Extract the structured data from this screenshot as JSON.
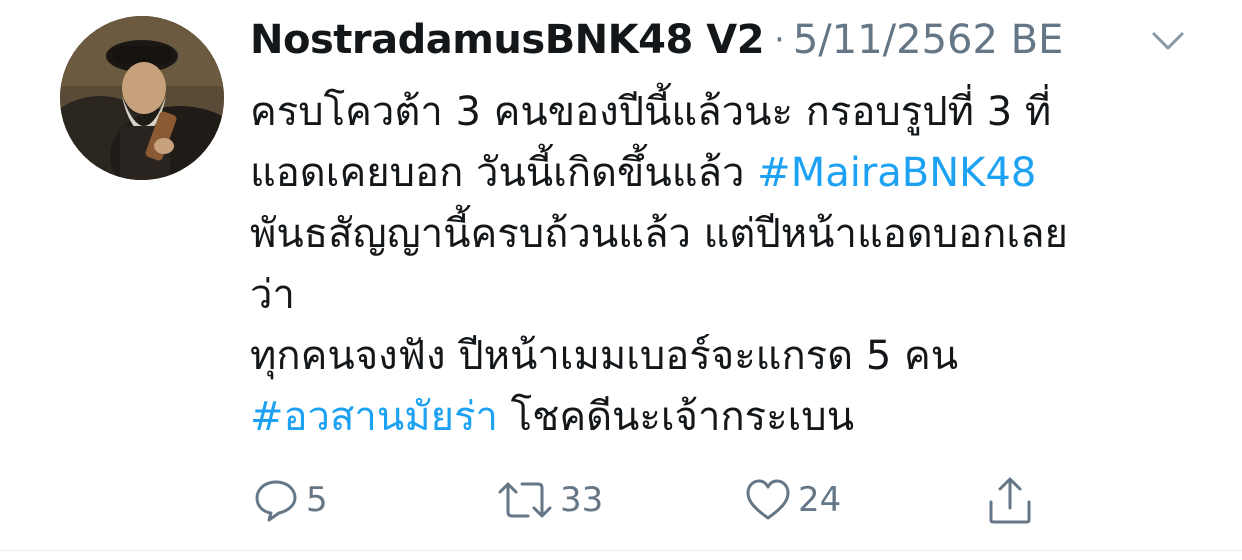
{
  "tweet": {
    "display_name": "NostradamusBNK48 V2",
    "separator": "·",
    "timestamp": "5/11/2562 BE",
    "lines": [
      {
        "segments": [
          {
            "text": "ครบโควต้า 3 คนของปีนี้แล้วนะ กรอบรูปที่ 3 ที่",
            "hashtag": false
          }
        ]
      },
      {
        "segments": [
          {
            "text": "แอดเคยบอก วันนี้เกิดขึ้นแล้ว ",
            "hashtag": false
          },
          {
            "text": "#MairaBNK48",
            "hashtag": true
          }
        ]
      },
      {
        "segments": [
          {
            "text": "พันธสัญญานี้ครบถ้วนแล้ว แต่ปีหน้าแอดบอกเลย",
            "hashtag": false
          }
        ]
      },
      {
        "segments": [
          {
            "text": "ว่า",
            "hashtag": false
          }
        ]
      },
      {
        "segments": [
          {
            "text": "ทุกคนจงฟัง ปีหน้าเมมเบอร์จะแกรด 5 คน",
            "hashtag": false
          }
        ]
      },
      {
        "segments": [
          {
            "text": "#อวสานมัยร่า",
            "hashtag": true
          },
          {
            "text": " โชคดีนะเจ้ากระเบน",
            "hashtag": false
          }
        ]
      }
    ],
    "hashtag_color": "#1da1f2"
  },
  "actions": {
    "reply": {
      "icon": "reply-icon",
      "count": "5"
    },
    "retweet": {
      "icon": "retweet-icon",
      "count": "33"
    },
    "like": {
      "icon": "heart-icon",
      "count": "24"
    },
    "share": {
      "icon": "share-icon"
    }
  },
  "colors": {
    "text": "#14171a",
    "secondary": "#657786",
    "link": "#1da1f2"
  }
}
